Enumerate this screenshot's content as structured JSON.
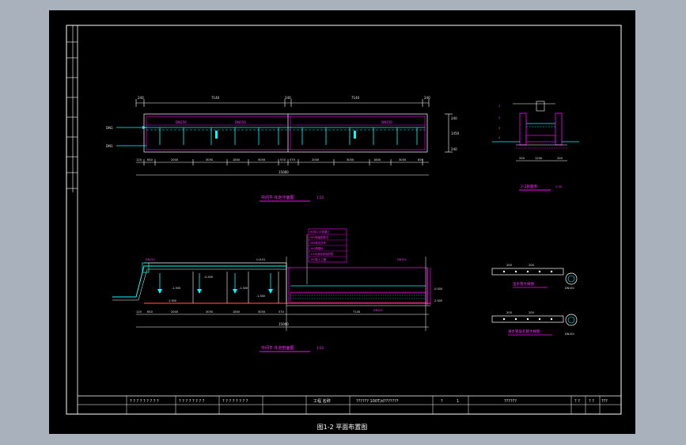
{
  "drawing": {
    "plan_view": {
      "top_dims": [
        "240",
        "7140",
        "240",
        "7140",
        "240"
      ],
      "inner_labels": [
        "DN150",
        "DN150",
        "DN150"
      ],
      "left_labels": [
        "DN1",
        "DN1"
      ],
      "bottom_dims": [
        "120",
        "650",
        "2000",
        "3050",
        "1800",
        "3050",
        "570",
        "570",
        "2000",
        "3050",
        "1800",
        "3050",
        "650"
      ],
      "total_dim": "15060",
      "right_dims": [
        "240",
        "1450",
        "240"
      ],
      "title": "中间牛 化池平面图",
      "scale": "1:50"
    },
    "section_view": {
      "layer_labels": [
        "60厚C15混凝土",
        "500厚级配砂石",
        "200厚无纺布",
        "100厚粗砂",
        "1:2水泥砂浆保护层",
        "100厚土工膜"
      ],
      "elev_labels": [
        "-0.500",
        "-1.300",
        "-1.300",
        "-1.300",
        "-0.500",
        "-2.500",
        "-1.900"
      ],
      "note_labels": [
        "DN150",
        "DN150",
        "DN100",
        "i=0.01"
      ],
      "bottom_dims": [
        "120",
        "650",
        "2000",
        "3050",
        "1800",
        "3050",
        "570",
        "7140"
      ],
      "total_dim": "15060",
      "title": "中间牛 化池剖面图",
      "scale": "1:50"
    },
    "detail_a": {
      "labels": [
        "1",
        "2",
        "3",
        "4"
      ],
      "dims": [
        "200",
        "1200",
        "200"
      ],
      "title": "2-2剖面图",
      "scale": "1:30"
    },
    "detail_b": {
      "labels": [
        "200",
        "200",
        "DN150"
      ],
      "title": "出水管大样图"
    },
    "detail_c": {
      "labels": [
        "200",
        "200",
        "DN150"
      ],
      "title": "进水管穿孔管大样图"
    },
    "title_block": {
      "cells": [
        "? ? ? ? ? ? ? ? ?",
        "? ? ? ? ? ? ? ?",
        "? ? ? ? ? ? ? ?",
        "工程 名称",
        "??????  100T/d???????",
        "?",
        "1",
        "??????"
      ],
      "right_cells": [
        "? ?",
        "? ?",
        "???"
      ],
      "left_strip": [
        "?",
        "?",
        "?",
        "?",
        "?",
        "?",
        "?",
        "?",
        "?"
      ]
    },
    "caption": "图1-2 平面布置图"
  }
}
